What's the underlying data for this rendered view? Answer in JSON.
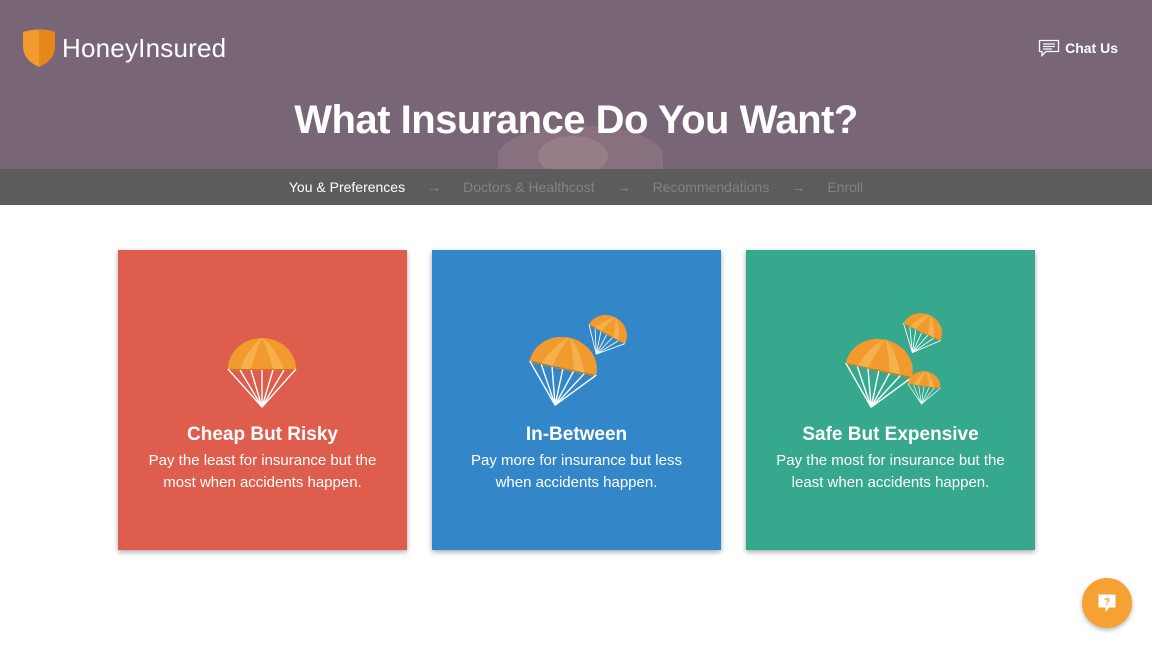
{
  "header": {
    "logo_text": "HoneyInsured",
    "chat_label": "Chat Us",
    "title": "What Insurance Do You Want?"
  },
  "steps": [
    {
      "label": "You & Preferences",
      "active": true
    },
    {
      "label": "Doctors & Healthcost",
      "active": false
    },
    {
      "label": "Recommendations",
      "active": false
    },
    {
      "label": "Enroll",
      "active": false
    }
  ],
  "step_arrow": "→",
  "cards": [
    {
      "title": "Cheap But Risky",
      "description": "Pay the least for insurance but the most when accidents happen.",
      "color": "#de5d4c",
      "icon": "one-parachute-icon"
    },
    {
      "title": "In-Between",
      "description": "Pay more for insurance but less when accidents happen.",
      "color": "#3387c8",
      "icon": "two-parachutes-icon"
    },
    {
      "title": "Safe But Expensive",
      "description": "Pay the most for insurance but the least when accidents happen.",
      "color": "#35a88e",
      "icon": "three-parachutes-icon"
    }
  ],
  "help_icon": "question-chat-icon",
  "colors": {
    "hero": "#786676",
    "steps_bar": "#5c5c5c",
    "accent_orange": "#f6a132"
  }
}
